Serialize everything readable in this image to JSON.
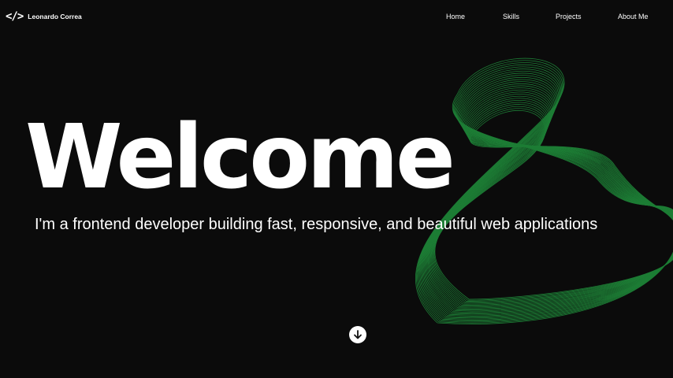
{
  "brand": {
    "logo_icon": "code-brackets-icon",
    "logo_glyph": "</>",
    "name": "Leonardo Correa"
  },
  "nav": {
    "items": [
      {
        "label": "Home"
      },
      {
        "label": "Skills"
      },
      {
        "label": "Projects"
      },
      {
        "label": "About Me"
      }
    ]
  },
  "hero": {
    "title": "Welcome",
    "subtitle": "I'm a frontend developer building fast, responsive, and beautiful web applications"
  },
  "scroll_button": {
    "icon": "arrow-down-icon"
  },
  "colors": {
    "background": "#0b0b0b",
    "accent": "#1f8a3a",
    "text": "#ffffff"
  }
}
